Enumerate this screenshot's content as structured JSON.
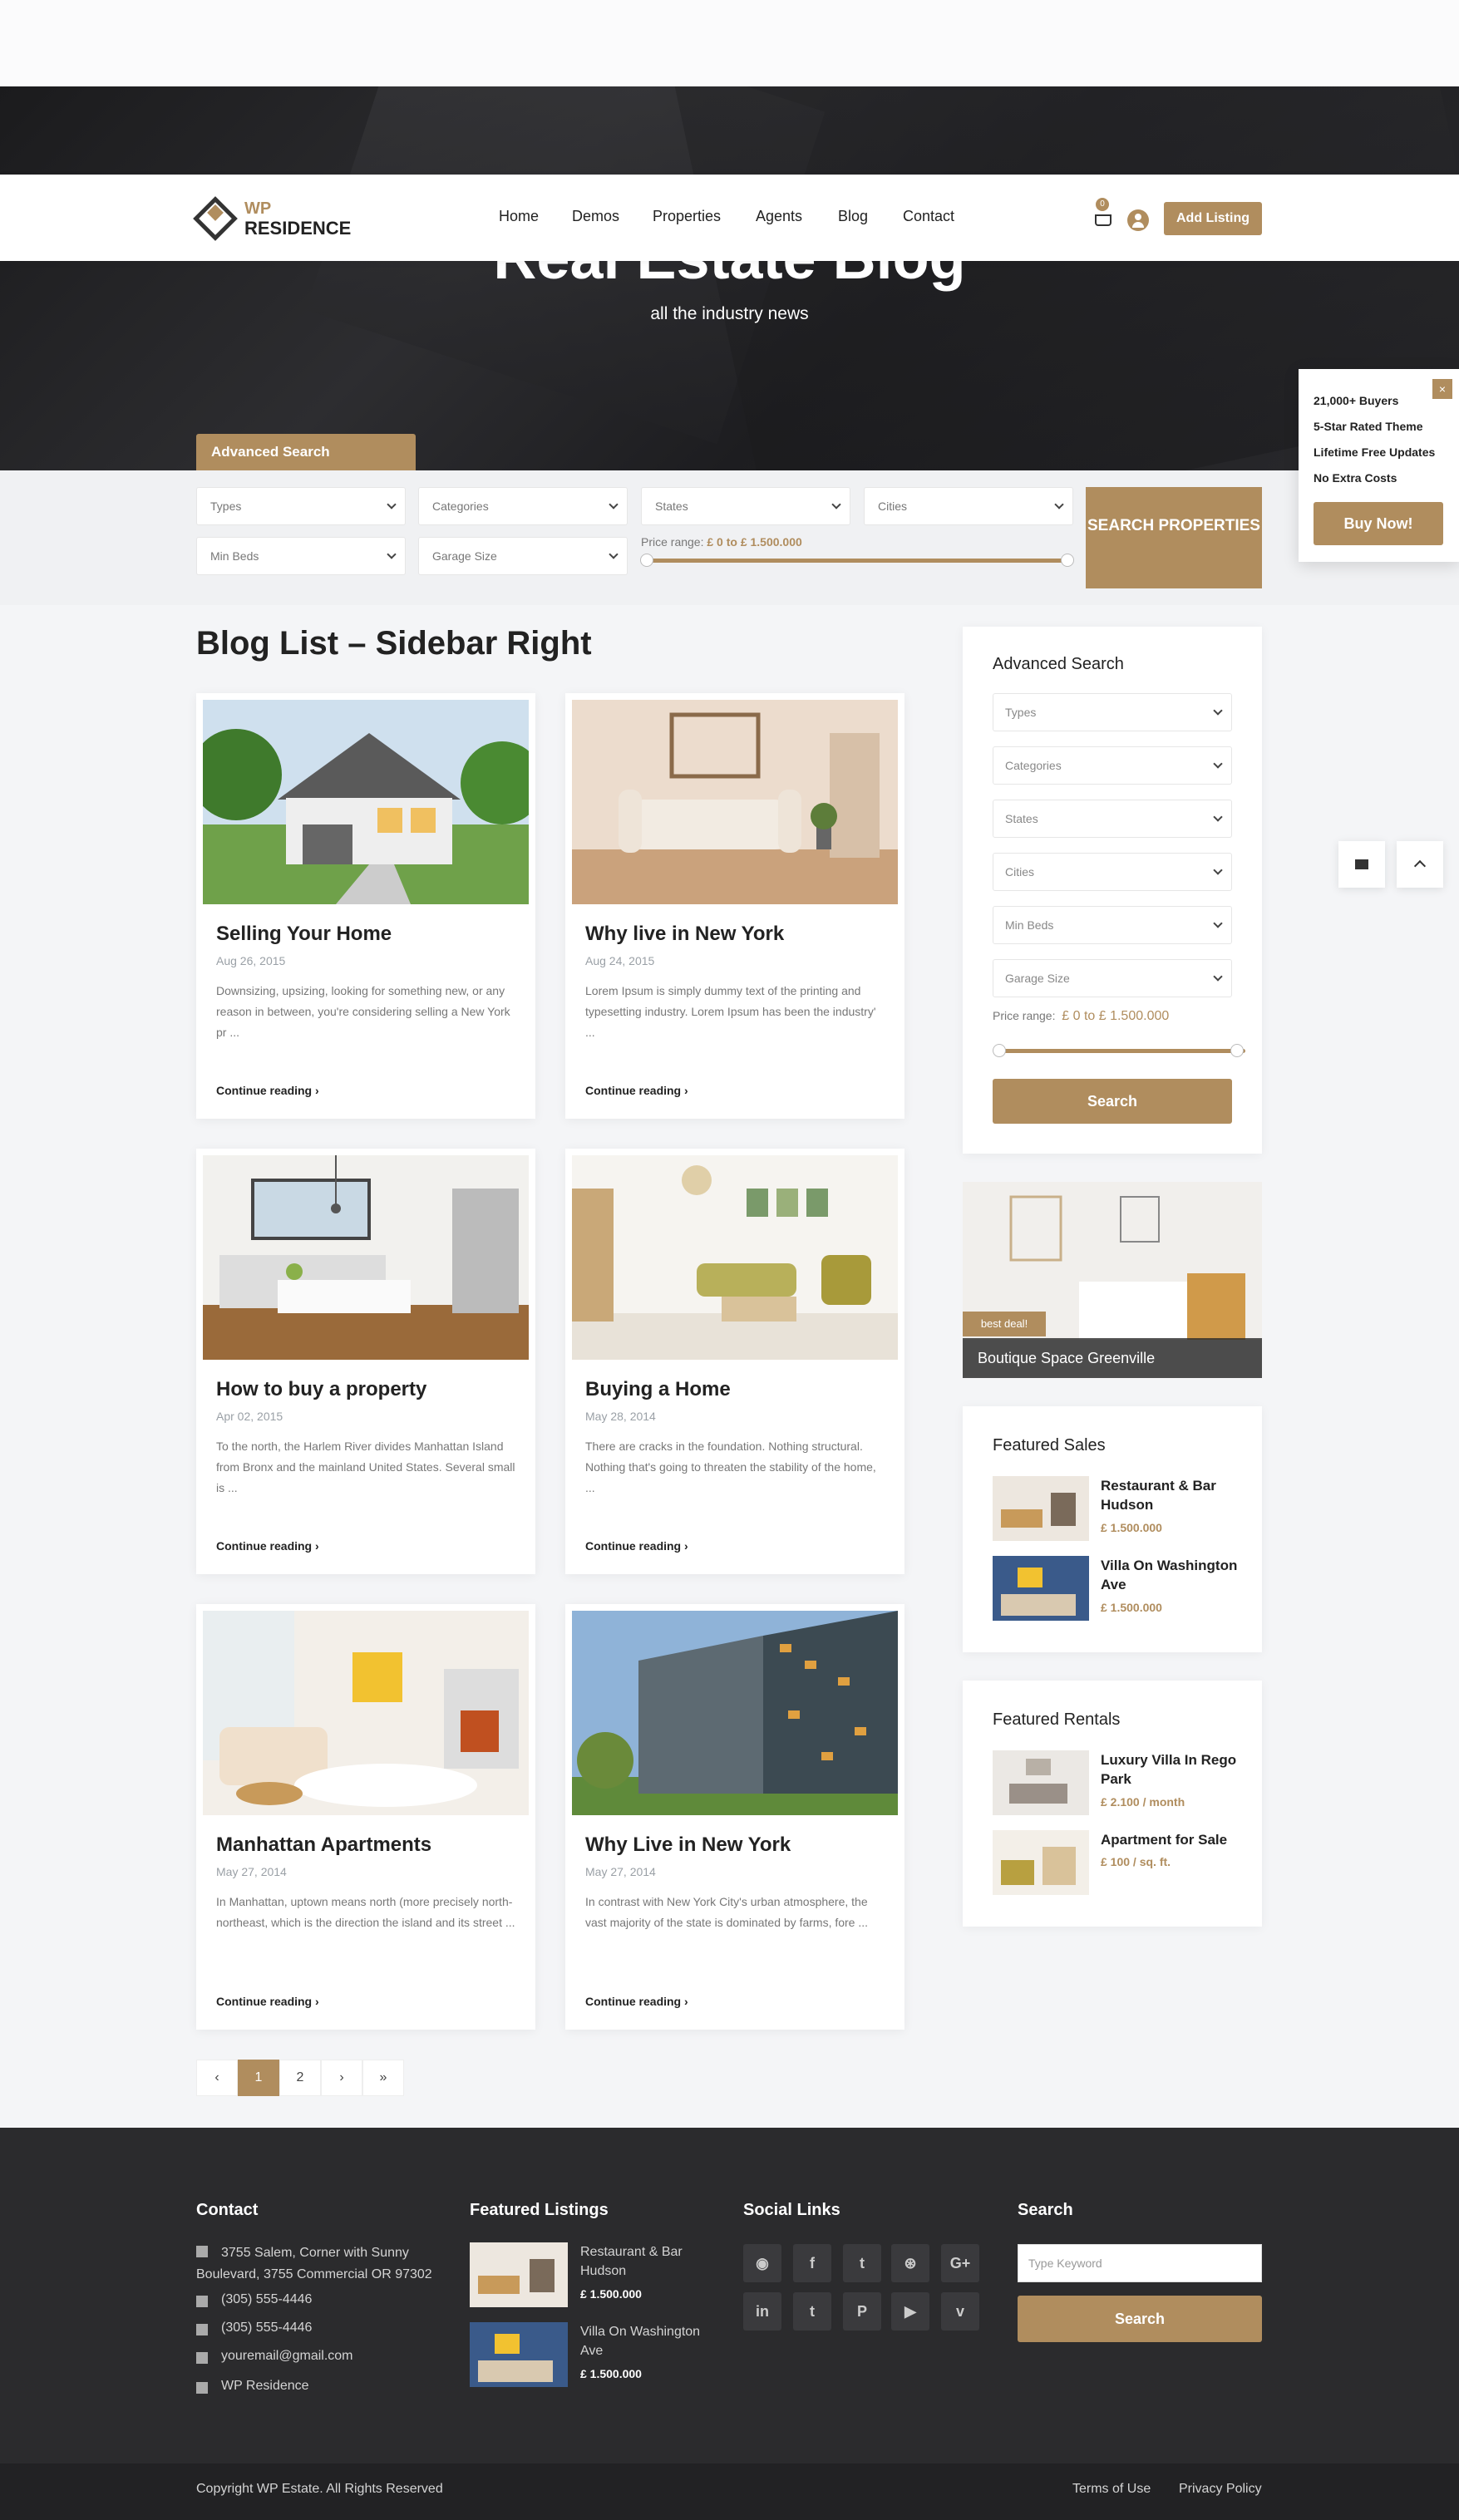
{
  "header": {
    "logo_top": "WP",
    "logo_bottom": "RESIDENCE",
    "nav": [
      "Home",
      "Demos",
      "Properties",
      "Agents",
      "Blog",
      "Contact"
    ],
    "cart_count": "0",
    "add_listing": "Add Listing"
  },
  "hero": {
    "title": "Real Estate Blog",
    "subtitle": "all the industry news"
  },
  "search_bar": {
    "tab_label": "Advanced Search",
    "types": "Types",
    "categories": "Categories",
    "states": "States",
    "cities": "Cities",
    "min_beds": "Min Beds",
    "garage": "Garage Size",
    "price_label": "Price range:",
    "price_value": "£ 0 to £ 1.500.000",
    "submit": "SEARCH PROPERTIES"
  },
  "promo": {
    "close": "×",
    "lines": [
      "21,000+ Buyers",
      "5-Star Rated Theme",
      "Lifetime Free Updates",
      "No Extra Costs"
    ],
    "cta": "Buy Now!"
  },
  "main": {
    "title": "Blog List – Sidebar Right",
    "read_more": "Continue reading",
    "posts": [
      {
        "title": "Selling Your Home",
        "date": "Aug 26, 2015",
        "excerpt": "Downsizing, upsizing, looking for something new, or any reason in between, you're considering selling a New York pr ..."
      },
      {
        "title": "Why live in New York",
        "date": "Aug 24, 2015",
        "excerpt": "Lorem Ipsum is simply dummy text of the printing and typesetting industry. Lorem Ipsum has been the industry' ..."
      },
      {
        "title": "How to buy a property",
        "date": "Apr 02, 2015",
        "excerpt": "To the north, the Harlem River divides Manhattan Island from Bronx and the mainland United States. Several small is ..."
      },
      {
        "title": "Buying a Home",
        "date": "May 28, 2014",
        "excerpt": "There are cracks in the foundation. Nothing structural. Nothing that's going to threaten the stability of the home, ..."
      },
      {
        "title": "Manhattan Apartments",
        "date": "May 27, 2014",
        "excerpt": "In Manhattan, uptown means north (more precisely north-northeast, which is the direction the island and its street ..."
      },
      {
        "title": "Why Live in New York",
        "date": "May 27, 2014",
        "excerpt": "In contrast with New York City's urban atmosphere, the vast majority of the state is dominated by farms, fore ..."
      }
    ],
    "pagination": [
      "‹",
      "1",
      "2",
      "›",
      "»"
    ]
  },
  "sidebar": {
    "adv_title": "Advanced Search",
    "fields": [
      "Types",
      "Categories",
      "States",
      "Cities",
      "Min Beds",
      "Garage Size"
    ],
    "price_label": "Price range:",
    "price_value": "£ 0 to £ 1.500.000",
    "search": "Search",
    "deal_badge": "best deal!",
    "deal_title": "Boutique Space Greenville",
    "featured_sales_title": "Featured Sales",
    "featured_sales": [
      {
        "title": "Restaurant & Bar Hudson",
        "price": "£ 1.500.000"
      },
      {
        "title": "Villa On Washington Ave",
        "price": "£ 1.500.000"
      }
    ],
    "featured_rentals_title": "Featured Rentals",
    "featured_rentals": [
      {
        "title": "Luxury Villa In Rego Park",
        "price": "£ 2.100 / month"
      },
      {
        "title": "Apartment for Sale",
        "price": "£ 100 / sq. ft."
      }
    ]
  },
  "footer": {
    "contact_title": "Contact",
    "address": "3755 Salem, Corner with Sunny Boulevard, 3755 Commercial OR 97302",
    "phone": "(305) 555-4446",
    "fax": "(305) 555-4446",
    "email": "youremail@gmail.com",
    "site": "WP Residence",
    "featured_title": "Featured Listings",
    "featured": [
      {
        "title": "Restaurant & Bar Hudson",
        "price": "£ 1.500.000"
      },
      {
        "title": "Villa On Washington Ave",
        "price": "£ 1.500.000"
      }
    ],
    "social_title": "Social Links",
    "social": [
      "rss-icon",
      "facebook-icon",
      "twitter-icon",
      "dribbble-icon",
      "google-plus-icon",
      "linkedin-icon",
      "tumblr-icon",
      "pinterest-icon",
      "youtube-icon",
      "vimeo-icon"
    ],
    "social_glyphs": [
      "◉",
      "f",
      "t",
      "⊛",
      "G+",
      "in",
      "t",
      "P",
      "▶",
      "v"
    ],
    "search_title": "Search",
    "search_placeholder": "Type Keyword",
    "search_button": "Search",
    "copyright": "Copyright WP Estate. All Rights Reserved",
    "terms": "Terms of Use",
    "privacy": "Privacy Policy"
  },
  "colors": {
    "accent": "#b08d5e",
    "dark": "#2b2b2d"
  }
}
